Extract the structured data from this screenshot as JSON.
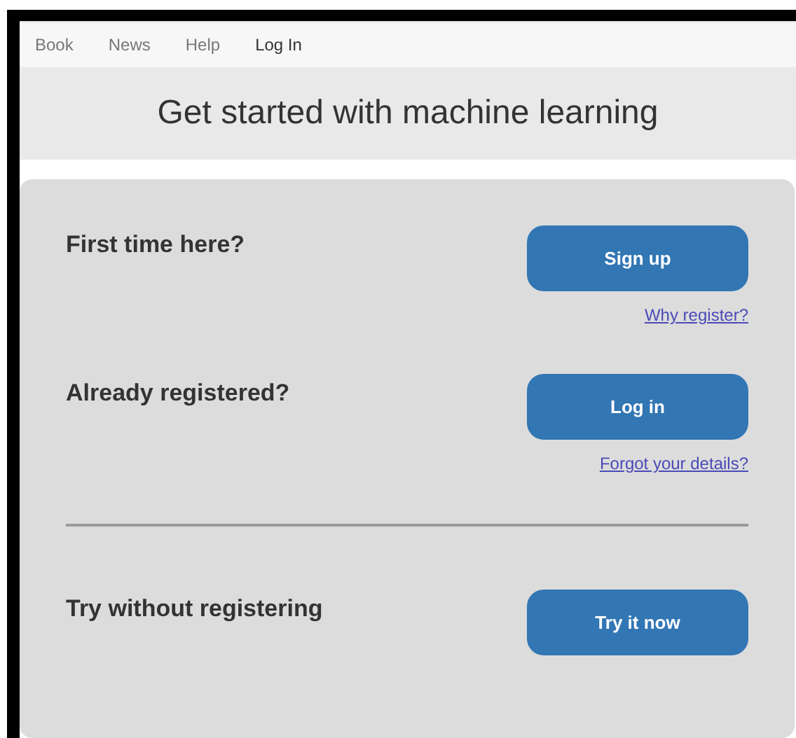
{
  "nav": {
    "items": [
      {
        "label": "Book",
        "selected": false
      },
      {
        "label": "News",
        "selected": false
      },
      {
        "label": "Help",
        "selected": false
      },
      {
        "label": "Log In",
        "selected": true
      }
    ]
  },
  "banner": {
    "title": "Get started with machine learning"
  },
  "sections": [
    {
      "heading": "First time here?",
      "button": "Sign up",
      "link": "Why register?",
      "divider_before": false
    },
    {
      "heading": "Already registered?",
      "button": "Log in",
      "link": "Forgot your details?",
      "divider_before": false
    },
    {
      "heading": "Try without registering",
      "button": "Try it now",
      "divider_before": true
    }
  ]
}
